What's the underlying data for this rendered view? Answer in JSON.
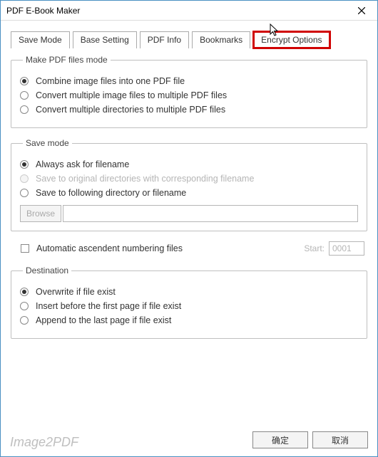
{
  "window": {
    "title": "PDF E-Book Maker"
  },
  "tabs": {
    "save_mode": "Save Mode",
    "base_setting": "Base Setting",
    "pdf_info": "PDF Info",
    "bookmarks": "Bookmarks",
    "encrypt_options": "Encrypt Options"
  },
  "groups": {
    "make_mode": {
      "legend": "Make PDF files mode",
      "opt_combine": "Combine image files into one PDF file",
      "opt_multi_image": "Convert multiple image files to multiple PDF files",
      "opt_multi_dir": "Convert multiple directories to multiple PDF files"
    },
    "save_mode": {
      "legend": "Save mode",
      "opt_ask": "Always ask for filename",
      "opt_original": "Save to original directories with corresponding filename",
      "opt_following": "Save to following directory or filename",
      "browse": "Browse"
    },
    "numbering": {
      "check_label": "Automatic ascendent numbering files",
      "start_label": "Start:",
      "start_value": "0001"
    },
    "destination": {
      "legend": "Destination",
      "opt_overwrite": "Overwrite if file exist",
      "opt_insert": "Insert before the first page if file exist",
      "opt_append": "Append to the last page if file exist"
    }
  },
  "buttons": {
    "ok": "确定",
    "cancel": "取消"
  },
  "watermark": "Image2PDF"
}
